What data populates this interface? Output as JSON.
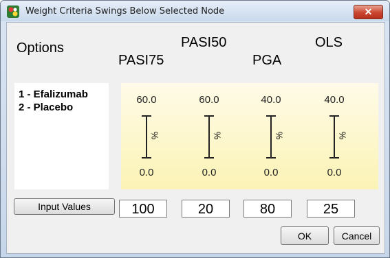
{
  "window": {
    "title": "Weight Criteria Swings Below Selected Node",
    "close_label": "✕"
  },
  "options": {
    "heading": "Options",
    "items": [
      "1 - Efalizumab",
      "2 - Placebo"
    ]
  },
  "criteria": [
    {
      "name": "PASI75",
      "max": "60.0",
      "min": "0.0",
      "unit": "%",
      "input": "100"
    },
    {
      "name": "PASI50",
      "max": "60.0",
      "min": "0.0",
      "unit": "%",
      "input": "20"
    },
    {
      "name": "PGA",
      "max": "40.0",
      "min": "0.0",
      "unit": "%",
      "input": "80"
    },
    {
      "name": "OLS",
      "max": "40.0",
      "min": "0.0",
      "unit": "%",
      "input": "25"
    }
  ],
  "buttons": {
    "input_values": "Input Values",
    "ok": "OK",
    "cancel": "Cancel"
  },
  "colors": {
    "panel_top": "#fffbe8",
    "panel_bottom": "#fbf3b5",
    "close": "#c9462f"
  }
}
